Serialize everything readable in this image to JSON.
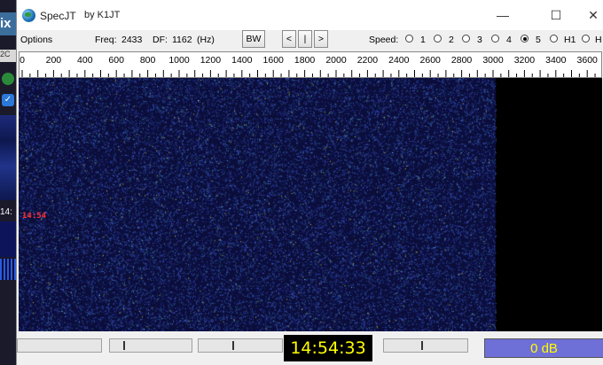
{
  "window": {
    "title": "SpecJT",
    "author": "by K1JT",
    "controls": {
      "minimize": "—",
      "maximize": "☐",
      "close": "✕"
    }
  },
  "background": {
    "title_fragment": "ix",
    "badge": "2C",
    "time_fragment": "14:"
  },
  "toolbar": {
    "options_label": "Options",
    "freq_label": "Freq:",
    "freq_value": "2433",
    "df_label": "DF:",
    "df_value": "1162",
    "df_unit": "(Hz)",
    "bw_label": "BW",
    "prev_label": "<",
    "center_label": "|",
    "next_label": ">",
    "speed_label": "Speed:",
    "speed_options": [
      "1",
      "2",
      "3",
      "4",
      "5",
      "H1",
      "H"
    ],
    "speed_selected": "5"
  },
  "scale": {
    "ticks": [
      "0",
      "200",
      "400",
      "600",
      "800",
      "1000",
      "1200",
      "1400",
      "1600",
      "1800",
      "2000",
      "2200",
      "2400",
      "2600",
      "2800",
      "3000",
      "3200",
      "3400",
      "3600"
    ]
  },
  "waterfall": {
    "time_marker": "14:54"
  },
  "status": {
    "clock": "14:54:33",
    "level": "0 dB"
  },
  "colors": {
    "waterfall_bg": "#0b0d3a",
    "noise": "#3a57c8",
    "clock_text": "#ffff00",
    "level_bar": "#6f6fd8",
    "marker": "#ff3030"
  }
}
